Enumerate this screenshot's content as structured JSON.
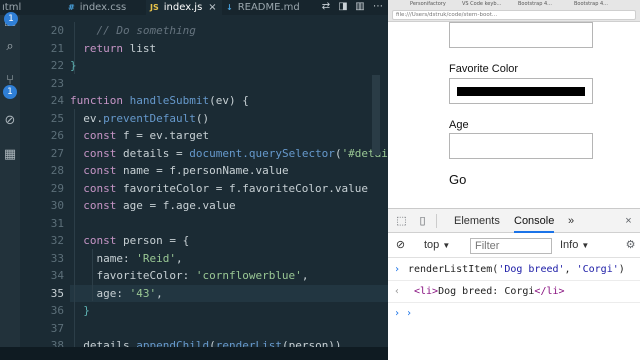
{
  "editor": {
    "tabs": [
      {
        "lang": "",
        "label": "ıtml"
      },
      {
        "lang": "JS",
        "label": "index.css"
      },
      {
        "lang": "JS",
        "label": "index.js",
        "active": true
      },
      {
        "lang": "",
        "label": "README.md"
      }
    ],
    "activity_badges": [
      "1",
      "1"
    ],
    "line_numbers": [
      "20",
      "21",
      "22",
      "23",
      "24",
      "25",
      "26",
      "27",
      "28",
      "29",
      "30",
      "31",
      "32",
      "33",
      "34",
      "35",
      "36",
      "37",
      "38"
    ],
    "current_line": "35",
    "code": {
      "l20": "// Do something",
      "l21_kw": "return",
      "l21_rest": " list",
      "l22": "}",
      "l24_kw": "function",
      "l24_fn": "handleSubmit",
      "l24_rest": "(ev) {",
      "l25_a": "ev.",
      "l25_fn": "preventDefault",
      "l25_b": "()",
      "l26_kw": "const",
      "l26_rest": " f = ev.target",
      "l27_kw": "const",
      "l27_a": " details = ",
      "l27_fn": "document.querySelector",
      "l27_b": "(",
      "l27_str": "'#detail",
      "l28_kw": "const",
      "l28_rest": " name = f.personName.value",
      "l29_kw": "const",
      "l29_rest": " favoriteColor = f.favoriteColor.value",
      "l30_kw": "const",
      "l30_rest": " age = f.age.value",
      "l32_kw": "const",
      "l32_rest": " person = {",
      "l33_key": "name: ",
      "l33_str": "'Reid'",
      "l33_end": ",",
      "l34_key": "favoriteColor: ",
      "l34_str": "'cornflowerblue'",
      "l34_end": ",",
      "l35_key": "age: ",
      "l35_str": "'43'",
      "l35_end": ",",
      "l36": "}",
      "l38_a": "details.",
      "l38_fn": "appendChild",
      "l38_b": "(",
      "l38_fn2": "renderList",
      "l38_c": "(person))"
    }
  },
  "browser": {
    "tabs": [
      "Personifactory",
      "VS Code keyb...",
      "Bootstrap 4...",
      "Bootstrap 4..."
    ],
    "url": "file:///Users/dstruk/code/stern-boot...",
    "form": {
      "favorite_color_label": "Favorite Color",
      "age_label": "Age",
      "go_label": "Go",
      "swatch_color": "#000000"
    }
  },
  "devtools": {
    "tabs": {
      "elements": "Elements",
      "console": "Console",
      "more": "»"
    },
    "context": "top",
    "filter_placeholder": "Filter",
    "level": "Info",
    "console": {
      "input_cmd": "renderListItem(",
      "input_arg1": "'Dog breed'",
      "input_sep": ", ",
      "input_arg2": "'Corgi'",
      "input_end": ")",
      "output_open": "<li>",
      "output_text": "Dog breed: Corgi",
      "output_close": "</li>"
    }
  },
  "colors": {
    "editor_bg": "#1b2b34",
    "keyword": "#c594c5",
    "function": "#6699cc",
    "string": "#99c794",
    "accent": "#1a73e8"
  }
}
